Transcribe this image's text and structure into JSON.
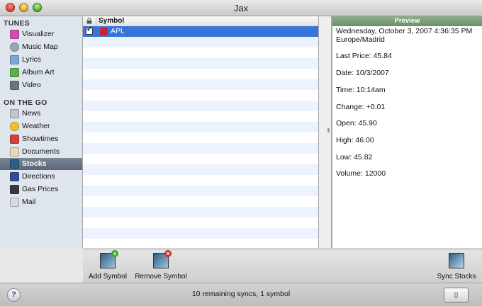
{
  "window": {
    "title": "Jax"
  },
  "sidebar": {
    "sections": [
      {
        "label": "TUNES",
        "items": [
          {
            "label": "Visualizer",
            "icon": "visualizer-icon",
            "color": "#d34bb6"
          },
          {
            "label": "Music Map",
            "icon": "music-map-icon",
            "color": "#9aa7b6"
          },
          {
            "label": "Lyrics",
            "icon": "lyrics-icon",
            "color": "#7aa6d8"
          },
          {
            "label": "Album Art",
            "icon": "album-art-icon",
            "color": "#59b24a"
          },
          {
            "label": "Video",
            "icon": "video-icon",
            "color": "#6c7480"
          }
        ]
      },
      {
        "label": "ON THE GO",
        "items": [
          {
            "label": "News",
            "icon": "news-icon",
            "color": "#bfc6cf"
          },
          {
            "label": "Weather",
            "icon": "weather-icon",
            "color": "#f2c12a"
          },
          {
            "label": "Showtimes",
            "icon": "showtimes-icon",
            "color": "#d0433a"
          },
          {
            "label": "Documents",
            "icon": "documents-icon",
            "color": "#e6d8b8"
          },
          {
            "label": "Stocks",
            "icon": "stocks-icon",
            "color": "#2e5f86",
            "active": true
          },
          {
            "label": "Directions",
            "icon": "directions-icon",
            "color": "#2f4f9a"
          },
          {
            "label": "Gas Prices",
            "icon": "gas-prices-icon",
            "color": "#3a3a3a"
          },
          {
            "label": "Mail",
            "icon": "mail-icon",
            "color": "#d9d9e4"
          }
        ]
      }
    ]
  },
  "table": {
    "column_symbol": "Symbol",
    "rows": [
      {
        "symbol": "APL",
        "checked": true,
        "selected": true
      }
    ]
  },
  "preview": {
    "header": "Preview",
    "datetime": "Wednesday, October 3, 2007 4:36:35 PM",
    "timezone": "Europe/Madrid",
    "fields": [
      "Last Price: 45.84",
      "Date: 10/3/2007",
      "Time: 10:14am",
      "Change: +0.01",
      "Open: 45.90",
      "High: 46.00",
      "Low: 45.82",
      "Volume: 12000"
    ]
  },
  "toolbar": {
    "add_label": "Add Symbol",
    "remove_label": "Remove Symbol",
    "sync_label": "Sync Stocks"
  },
  "status": {
    "text": "10 remaining syncs, 1 symbol",
    "help": "?"
  },
  "colors": {
    "selection": "#3875d7",
    "preview_header": "#7a9e78",
    "add_badge": "#3aa33a",
    "remove_badge": "#c9302c"
  }
}
